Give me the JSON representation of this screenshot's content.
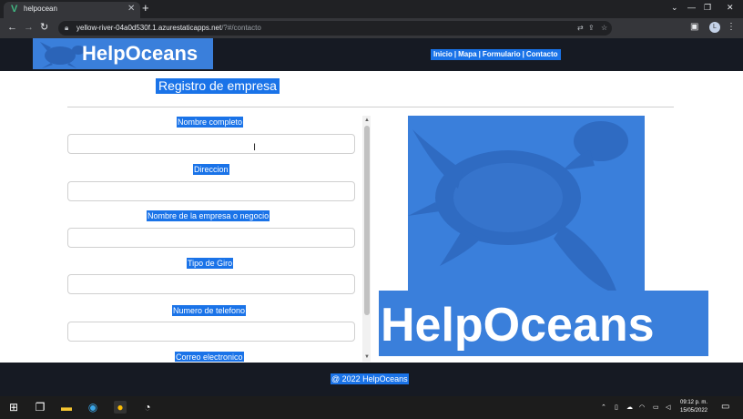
{
  "browser": {
    "tab_title": "helpocean",
    "tab_close": "✕",
    "new_tab": "+",
    "window_controls": [
      "⌄",
      "—",
      "❐",
      "✕"
    ],
    "url_host": "yellow-river-04a0d530f.1.azurestaticapps.net",
    "url_path": "/?#/contacto",
    "nav_back": "←",
    "nav_forward": "→",
    "nav_reload": "↻",
    "profile_initial": "L"
  },
  "site": {
    "logo": "HelpOceans",
    "nav": [
      "Inicio",
      "|",
      "Mapa",
      "|",
      "Formulario",
      "|",
      "Contacto"
    ],
    "heading": "Registro de empresa",
    "form_labels": [
      "Nombre completo",
      "Direccion",
      "Nombre de la empresa o negocio",
      "Tipo de Giro",
      "Numero de telefono",
      "Correo electronico"
    ],
    "hero_text": "HelpOceans",
    "footer": "@ 2022 HelpOceans"
  },
  "taskbar": {
    "time": "09:12 p. m.",
    "date": "15/05/2022"
  },
  "colors": {
    "accent": "#1a73e8",
    "brand": "#3a7fdb",
    "header_bg": "#161a23"
  }
}
